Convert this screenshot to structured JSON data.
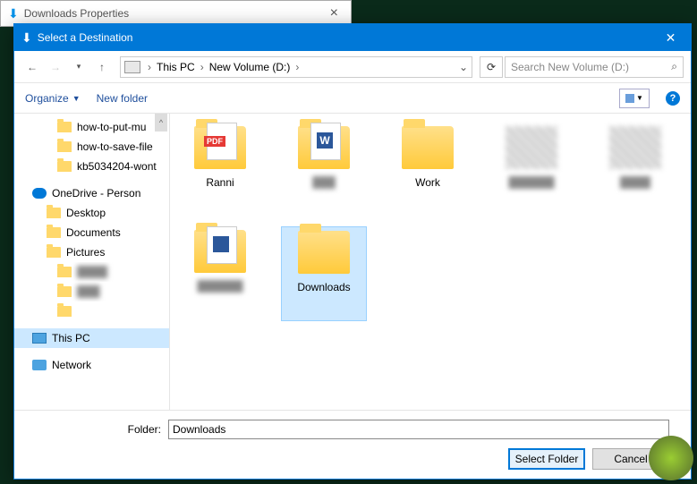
{
  "bg_window": {
    "title": "Downloads Properties"
  },
  "dialog": {
    "title": "Select a Destination",
    "breadcrumb": {
      "root": "This PC",
      "drive": "New Volume (D:)"
    },
    "search_placeholder": "Search New Volume (D:)",
    "toolbar": {
      "organize": "Organize",
      "new_folder": "New folder"
    },
    "sidebar": {
      "items": [
        {
          "label": "how-to-put-mu",
          "type": "folder"
        },
        {
          "label": "how-to-save-file",
          "type": "folder"
        },
        {
          "label": "kb5034204-wont",
          "type": "folder"
        }
      ],
      "onedrive": "OneDrive - Person",
      "onedrive_children": [
        "Desktop",
        "Documents",
        "Pictures"
      ],
      "this_pc": "This PC",
      "network": "Network"
    },
    "grid": [
      {
        "label": "Ranni",
        "kind": "folder-pdf"
      },
      {
        "label": "",
        "kind": "folder-word",
        "blur": true
      },
      {
        "label": "Work",
        "kind": "folder"
      },
      {
        "label": "",
        "kind": "blur"
      },
      {
        "label": "",
        "kind": "blur"
      },
      {
        "label": "",
        "kind": "folder-word2",
        "blur": true
      },
      {
        "label": "Downloads",
        "kind": "folder",
        "selected": true
      }
    ],
    "footer": {
      "folder_label": "Folder:",
      "folder_value": "Downloads",
      "select_btn": "Select Folder",
      "cancel_btn": "Cancel"
    }
  }
}
